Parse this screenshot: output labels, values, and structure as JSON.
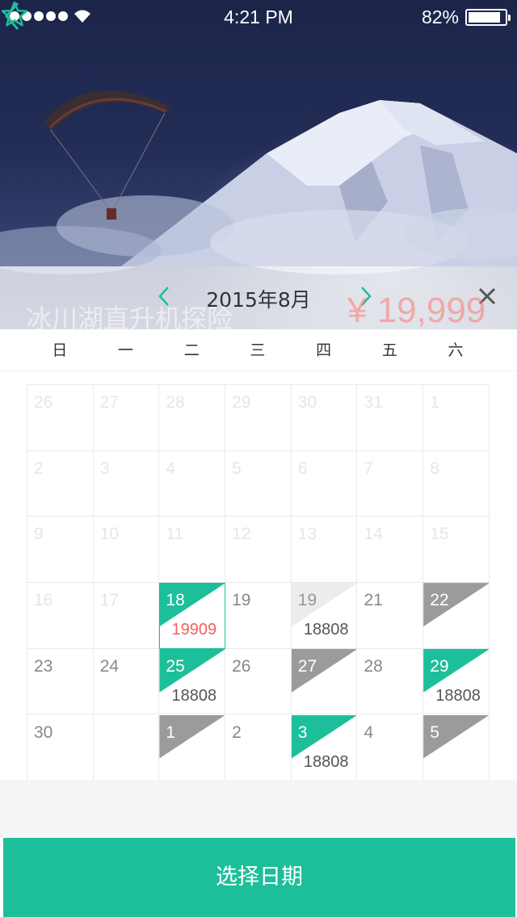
{
  "status_bar": {
    "time": "4:21 PM",
    "battery": "82%"
  },
  "hero": {
    "title": "冰川湖直升机探险",
    "price": "¥ 19,999"
  },
  "calendar": {
    "month_title": "2015年8月",
    "weekdays": [
      "日",
      "一",
      "二",
      "三",
      "四",
      "五",
      "六"
    ],
    "weeks": [
      [
        {
          "d": "26",
          "t": "dim"
        },
        {
          "d": "27",
          "t": "dim"
        },
        {
          "d": "28",
          "t": "dim"
        },
        {
          "d": "29",
          "t": "dim"
        },
        {
          "d": "30",
          "t": "dim"
        },
        {
          "d": "31",
          "t": "dim"
        },
        {
          "d": "1",
          "t": "dim"
        }
      ],
      [
        {
          "d": "2",
          "t": "dim"
        },
        {
          "d": "3",
          "t": "dim"
        },
        {
          "d": "4",
          "t": "dim"
        },
        {
          "d": "5",
          "t": "dim"
        },
        {
          "d": "6",
          "t": "dim"
        },
        {
          "d": "7",
          "t": "dim"
        },
        {
          "d": "8",
          "t": "dim"
        }
      ],
      [
        {
          "d": "9",
          "t": "dim"
        },
        {
          "d": "10",
          "t": "dim"
        },
        {
          "d": "11",
          "t": "dim"
        },
        {
          "d": "12",
          "t": "dim"
        },
        {
          "d": "13",
          "t": "dim"
        },
        {
          "d": "14",
          "t": "dim"
        },
        {
          "d": "15",
          "t": "dim"
        }
      ],
      [
        {
          "d": "16",
          "t": "dim"
        },
        {
          "d": "17",
          "t": "dim"
        },
        {
          "d": "18",
          "t": "green",
          "p": "19909",
          "sel": true
        },
        {
          "d": "19",
          "t": "normal"
        },
        {
          "d": "19",
          "t": "light",
          "p": "18808"
        },
        {
          "d": "21",
          "t": "normal"
        },
        {
          "d": "22",
          "t": "gray"
        }
      ],
      [
        {
          "d": "23",
          "t": "normal"
        },
        {
          "d": "24",
          "t": "normal"
        },
        {
          "d": "25",
          "t": "green",
          "p": "18808"
        },
        {
          "d": "26",
          "t": "normal"
        },
        {
          "d": "27",
          "t": "gray"
        },
        {
          "d": "28",
          "t": "normal"
        },
        {
          "d": "29",
          "t": "green",
          "p": "18808"
        }
      ],
      [
        {
          "d": "30",
          "t": "normal"
        },
        {
          "d": "",
          "t": "normal"
        },
        {
          "d": "1",
          "t": "gray"
        },
        {
          "d": "2",
          "t": "normal"
        },
        {
          "d": "3",
          "t": "green",
          "p": "18808"
        },
        {
          "d": "4",
          "t": "normal"
        },
        {
          "d": "5",
          "t": "gray"
        }
      ]
    ]
  },
  "confirm_button": "选择日期",
  "colors": {
    "accent": "#1dbf9a",
    "unavailable": "#9b9b9b",
    "selected_price": "#f0625a"
  }
}
